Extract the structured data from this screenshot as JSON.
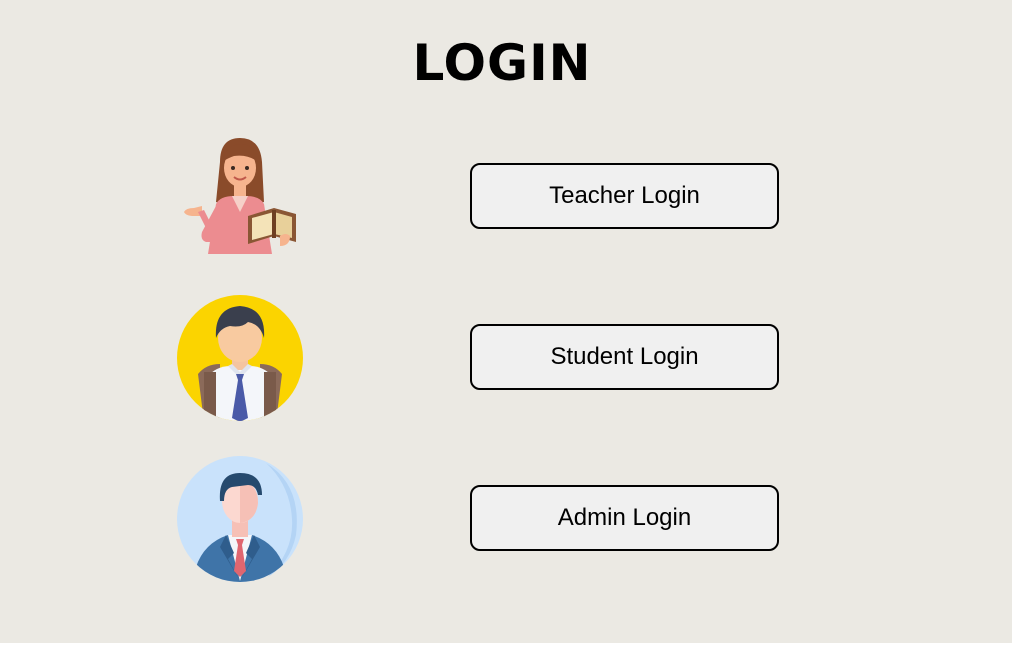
{
  "page": {
    "title": "LOGIN"
  },
  "roles": [
    {
      "id": "teacher",
      "button_label": "Teacher Login",
      "icon": "teacher-avatar-icon"
    },
    {
      "id": "student",
      "button_label": "Student Login",
      "icon": "student-avatar-icon"
    },
    {
      "id": "admin",
      "button_label": "Admin Login",
      "icon": "admin-avatar-icon"
    }
  ],
  "colors": {
    "background": "#ebe9e3",
    "button_background": "#f0f0f0",
    "button_border": "#000000",
    "student_avatar_bg": "#fbd400",
    "admin_avatar_bg": "#c9e2fb"
  }
}
